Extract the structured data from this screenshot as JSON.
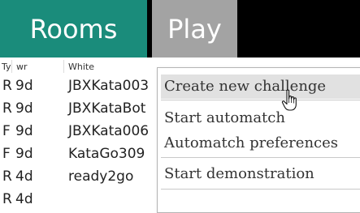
{
  "tabs": {
    "rooms": "Rooms",
    "play": "Play"
  },
  "table": {
    "headers": {
      "type": "Ty",
      "wr": "wr",
      "white": "White"
    },
    "rows": [
      {
        "type": "R",
        "wr": "9d",
        "white": "JBXKata003"
      },
      {
        "type": "R",
        "wr": "9d",
        "white": "JBXKataBot"
      },
      {
        "type": "F",
        "wr": "9d",
        "white": "JBXKata006"
      },
      {
        "type": "F",
        "wr": "9d",
        "white": "KataGo309"
      },
      {
        "type": "R",
        "wr": "4d",
        "white": "ready2go"
      },
      {
        "type": "R",
        "wr": "4d",
        "white": ""
      }
    ]
  },
  "menu": {
    "items": [
      {
        "label": "Create new challenge"
      },
      {
        "label": "Start automatch"
      },
      {
        "label": "Automatch preferences"
      },
      {
        "label": "Start demonstration"
      }
    ]
  },
  "colors": {
    "rooms_tab": "#1a8c7b",
    "play_tab": "#a3a3a3",
    "topbar": "#000000"
  },
  "icons": {
    "cursor": "hand-pointer-icon"
  }
}
